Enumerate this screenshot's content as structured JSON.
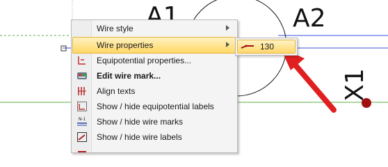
{
  "canvas": {
    "labels": {
      "a1": "A1",
      "a2": "A2",
      "x1": "X1"
    }
  },
  "context_menu": {
    "items": [
      {
        "label": "Wire style",
        "icon": "blank",
        "submenu": true,
        "bold": false
      },
      {
        "label": "Wire properties",
        "icon": "blank",
        "submenu": true,
        "bold": false,
        "highlighted": true
      },
      {
        "label": "Equipotential properties...",
        "icon": "equipotential-icon",
        "submenu": false,
        "bold": false
      },
      {
        "label": "Edit wire mark...",
        "icon": "wire-mark-icon",
        "submenu": false,
        "bold": true
      },
      {
        "label": "Align texts",
        "icon": "align-texts-icon",
        "submenu": false,
        "bold": false
      },
      {
        "label": "Show / hide equipotential labels",
        "icon": "equipotential-labels-icon",
        "submenu": false,
        "bold": false
      },
      {
        "label": "Show / hide wire marks",
        "icon": "wire-marks-icon",
        "submenu": false,
        "bold": false
      },
      {
        "label": "Show / hide wire labels",
        "icon": "wire-labels-icon",
        "submenu": false,
        "bold": false
      }
    ]
  },
  "submenu": {
    "item_label": "130",
    "icon": "wire-icon"
  },
  "colors": {
    "highlight_top": "#fff2c0",
    "highlight_bottom": "#ffd866",
    "arrow": "#e02020",
    "wire_blue": "#3b4fd8",
    "wire_green": "#58b04a"
  }
}
